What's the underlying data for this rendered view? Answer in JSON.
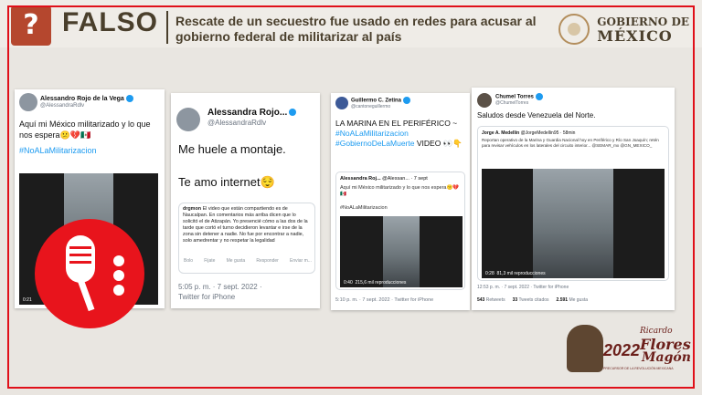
{
  "header": {
    "badge_glyph": "?",
    "verdict": "FALSO",
    "headline": "Rescate de un secuestro fue usado en redes para acusar al gobierno federal de militarizar al país",
    "gov_line1": "GOBIERNO DE",
    "gov_line2": "MÉXICO"
  },
  "colors": {
    "frame_red": "#e0101a",
    "verdict_brown": "#4a3f2c",
    "badge": "#b5472e",
    "twitter_blue": "#1d9bf0"
  },
  "tweets": [
    {
      "name": "Alessandro Rojo de la Vega",
      "handle": "@AlessandraRdlv",
      "text": "Aquí mi México militarizado y lo que nos espera😕💔🇲🇽",
      "hashtag": "#NoALaMilitarizacion",
      "video_time": "0:21"
    },
    {
      "name": "Alessandra Rojo...",
      "handle": "@AlessandraRdlv",
      "text1": "Me huele a montaje.",
      "text2": "Te amo internet😌",
      "quote_user": "drgmon",
      "quote_text": "El video que están compartiendo es de Naucalpan. En comentarios más arriba dicen que lo solicitó el de Atizapán. Yo presencié cómo a las dos de la tarde que cortó el turno decidieron levantar e irse de la zona sin detener a nadie. No fue por encontrar a nadie, solo amedrentar y no respetar la legalidad",
      "actions": [
        "Bolo",
        "Fijate",
        "Me gusta",
        "Responder",
        "Enviar m..."
      ],
      "time": "5:05 p. m. · 7 sept. 2022 ·",
      "source": "Twitter for iPhone"
    },
    {
      "name": "Guillermo C. Zetina",
      "handle": "@cantoneguillermo",
      "text": "LA MARINA EN EL PERIFÉRICO ~",
      "hashtag1": "#NoALaMilitarizacion",
      "hashtag2": "#GobiernoDeLaMuerte",
      "text_tail": "VIDEO 👀👇",
      "quote_name": "Alessandra Roj...",
      "quote_handle": "@Alessan... · 7 sept",
      "quote_text": "Aquí mi México militarizado y lo que nos espera😕💔🇲🇽",
      "quote_tag": "#NoALaMilitarizacion",
      "video_time": "0:40",
      "video_views": "215,6 mil reproducciones",
      "time": "5:10 p. m. · 7 sept. 2022 · Twitter for iPhone"
    },
    {
      "name": "Chumel Torres",
      "handle": "@ChumelTorres",
      "text": "Saludos desde Venezuela del Norte.",
      "quote_name": "Jorge A. Medellín",
      "quote_handle": "@JorgeMedellin95 · 58min",
      "quote_text": "Reportan operativo de la Marina y Guardia Nacional hoy en Periférico y Río San Joaquín; retén para revisar vehículos en los laterales del circuito interior... @SEMAR_mx @GN_MEXICO_",
      "video_time": "0:28",
      "video_views": "81,3 mil reproducciones",
      "time": "12:53 p. m. · 7 sept. 2022 · Twitter for iPhone",
      "retweets": "543",
      "retweets_label": "Retweets",
      "quotes": "33",
      "quotes_label": "Tweets citados",
      "likes": "2.591",
      "likes_label": "Me gusta"
    }
  ],
  "anniversary": {
    "year": "2022",
    "name1": "Ricardo",
    "name2": "Flores",
    "name3": "Magón",
    "sub": "PRECURSOR DE LA REVOLUCIÓN MEXICANA"
  }
}
